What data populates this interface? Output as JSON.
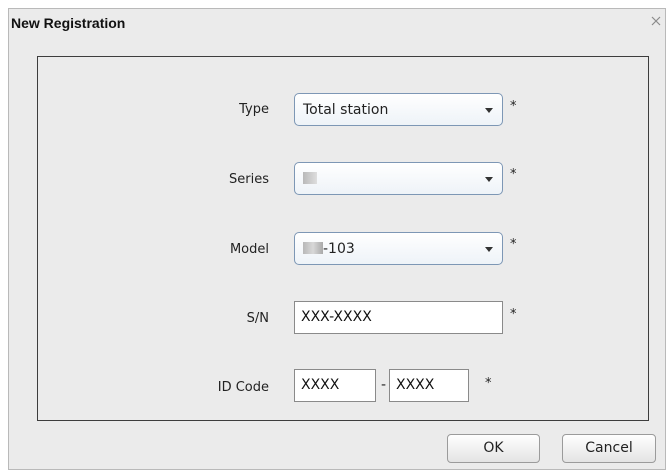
{
  "dialog": {
    "title": "New Registration",
    "close_icon": "close-icon"
  },
  "form": {
    "type": {
      "label": "Type",
      "value": "Total station",
      "required": "*"
    },
    "series": {
      "label": "Series",
      "value": "",
      "required": "*"
    },
    "model": {
      "label": "Model",
      "value_suffix": "-103",
      "required": "*"
    },
    "sn": {
      "label": "S/N",
      "value": "XXX-XXXX",
      "required": "*"
    },
    "id_code": {
      "label": "ID Code",
      "part1": "XXXX",
      "separator": "-",
      "part2": "XXXX",
      "required": "*"
    }
  },
  "buttons": {
    "ok": "OK",
    "cancel": "Cancel"
  },
  "colors": {
    "dialog_bg": "#ebebeb",
    "combo_border": "#7d97b5",
    "panel_border": "#3d3d3d"
  }
}
